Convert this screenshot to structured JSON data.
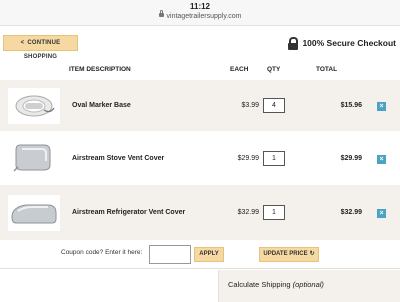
{
  "status_bar": {
    "time": "11:12",
    "url": "vintagetrailersupply.com"
  },
  "header": {
    "continue_label": "CONTINUE SHOPPING",
    "continue_arrow": "<",
    "secure_text": "100% Secure Checkout"
  },
  "table": {
    "columns": {
      "item": "ITEM DESCRIPTION",
      "each": "EACH",
      "qty": "QTY",
      "total": "TOTAL"
    },
    "rows": [
      {
        "name": "Oval Marker Base",
        "each": "$3.99",
        "qty": "4",
        "total": "$15.96",
        "image": "oval-marker-base"
      },
      {
        "name": "Airstream Stove Vent Cover",
        "each": "$29.99",
        "qty": "1",
        "total": "$29.99",
        "image": "stove-vent-cover"
      },
      {
        "name": "Airstream Refrigerator Vent Cover",
        "each": "$32.99",
        "qty": "1",
        "total": "$32.99",
        "image": "refrigerator-vent-cover"
      }
    ]
  },
  "coupon": {
    "label": "Coupon code? Enter it here:",
    "value": "",
    "apply_label": "APPLY"
  },
  "update_label": "UPDATE PRICE",
  "shipping": {
    "label": "Calculate Shipping",
    "optional": "(optional)"
  },
  "colors": {
    "button_bg": "#f6d9a2",
    "row_shade": "#f4f1ec",
    "remove_icon": "#4aa3c4"
  }
}
